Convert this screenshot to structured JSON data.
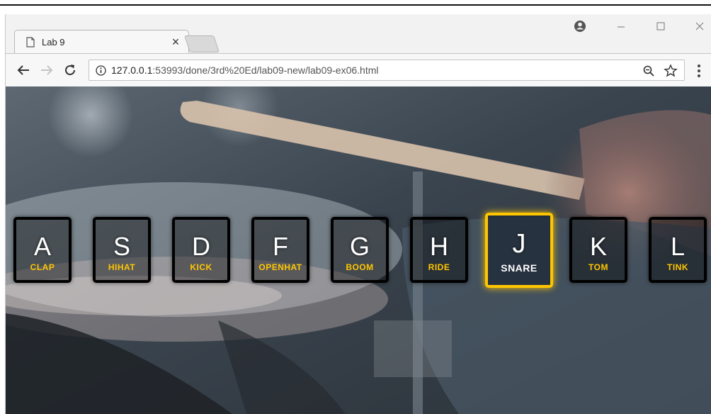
{
  "browser": {
    "tab_title": "Lab 9",
    "tab_close": "×",
    "url_host": "127.0.0.1",
    "url_rest": ":53993/done/3rd%20Ed/lab09-new/lab09-ex06.html"
  },
  "icons": [
    "page-icon",
    "account-icon",
    "minimize-icon",
    "maximize-icon",
    "close-icon",
    "back-arrow-icon",
    "forward-arrow-icon",
    "reload-icon",
    "info-icon",
    "zoom-icon",
    "star-icon",
    "more-menu-icon"
  ],
  "colors": {
    "accent": "#ffc600",
    "key_border": "#000000"
  },
  "keys": [
    {
      "letter": "A",
      "sound": "CLAP"
    },
    {
      "letter": "S",
      "sound": "HIHAT"
    },
    {
      "letter": "D",
      "sound": "KICK"
    },
    {
      "letter": "F",
      "sound": "OPENHAT"
    },
    {
      "letter": "G",
      "sound": "BOOM"
    },
    {
      "letter": "H",
      "sound": "RIDE"
    },
    {
      "letter": "J",
      "sound": "SNARE",
      "playing": true
    },
    {
      "letter": "K",
      "sound": "TOM"
    },
    {
      "letter": "L",
      "sound": "TINK"
    }
  ]
}
